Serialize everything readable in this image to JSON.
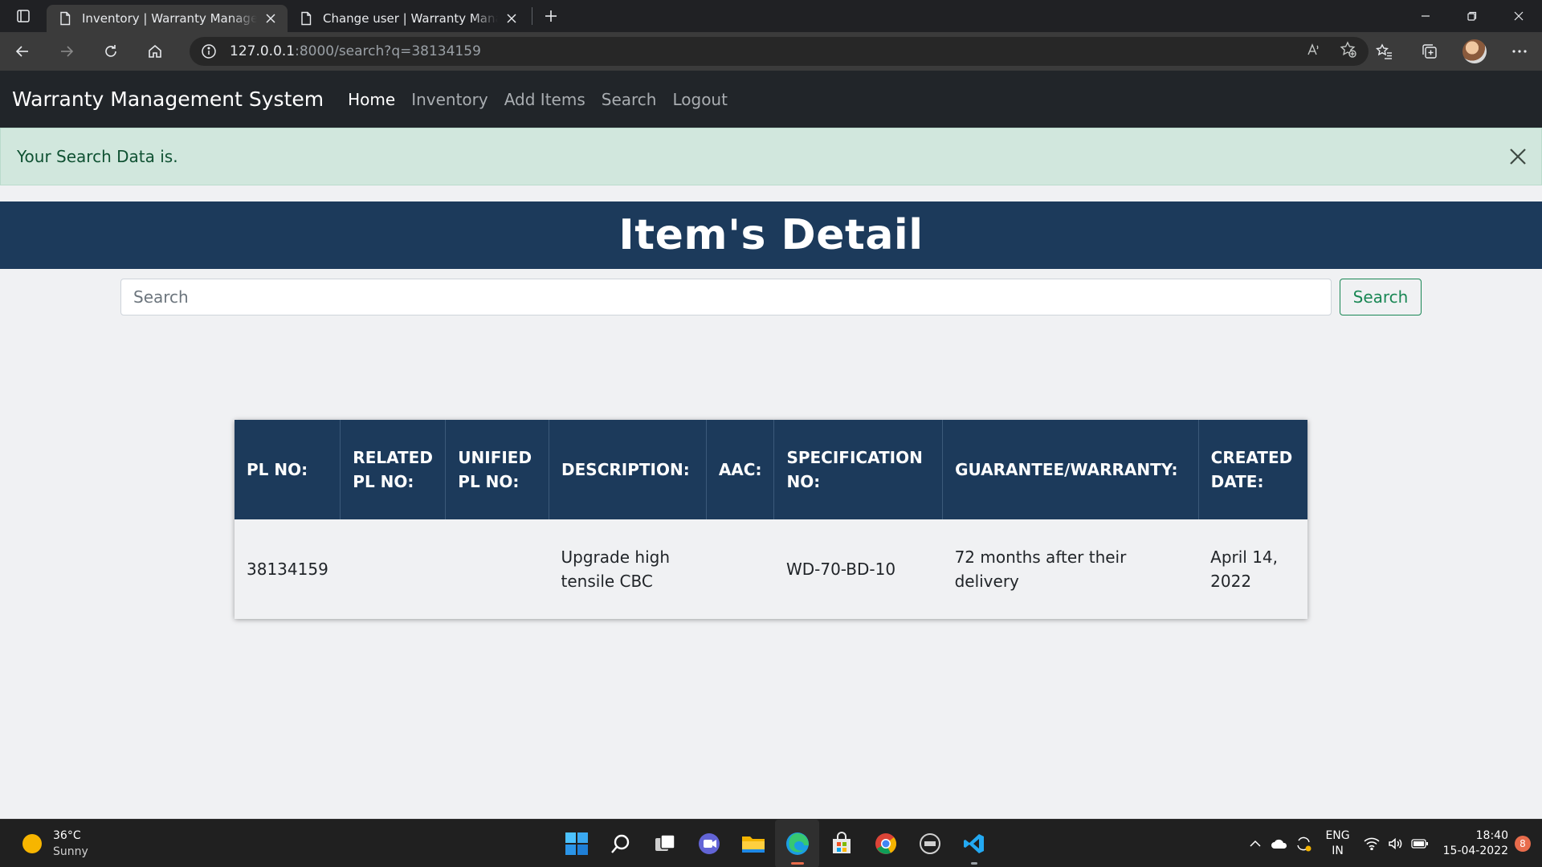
{
  "browser": {
    "tabs": [
      {
        "title": "Inventory | Warranty Management System",
        "active": true
      },
      {
        "title": "Change user | Warranty Management System",
        "active": false
      }
    ],
    "url_host": "127.0.0.1",
    "url_rest": ":8000/search?q=38134159"
  },
  "navbar": {
    "brand": "Warranty Management System",
    "links": [
      "Home",
      "Inventory",
      "Add Items",
      "Search",
      "Logout"
    ],
    "active": "Home"
  },
  "alert": {
    "message": "Your Search Data is."
  },
  "page": {
    "title": "Item's Detail",
    "search_placeholder": "Search",
    "search_value": "",
    "search_button": "Search"
  },
  "table": {
    "headers": [
      "PL NO:",
      "RELATED PL NO:",
      "UNIFIED PL NO:",
      "DESCRIPTION:",
      "AAC:",
      "SPECIFICATION NO:",
      "GUARANTEE/WARRANTY:",
      "CREATED DATE:"
    ],
    "rows": [
      [
        "38134159",
        "",
        "",
        "Upgrade high tensile CBC",
        "",
        "WD-70-BD-10",
        "72 months after their delivery",
        "April 14, 2022"
      ]
    ]
  },
  "taskbar": {
    "temperature": "36°C",
    "weather": "Sunny",
    "lang_top": "ENG",
    "lang_bottom": "IN",
    "time": "18:40",
    "date": "15-04-2022",
    "notifications": "8",
    "apps": [
      "start-icon",
      "search-icon",
      "task-view-icon",
      "teams-chat-icon",
      "file-explorer-icon",
      "edge-icon",
      "store-icon",
      "chrome-icon",
      "dell-icon",
      "vscode-icon"
    ]
  },
  "colors": {
    "navbar_bg": "#212529",
    "hero_bg": "#1c3a5b",
    "alert_bg": "#d1e7dd",
    "success": "#198754"
  }
}
